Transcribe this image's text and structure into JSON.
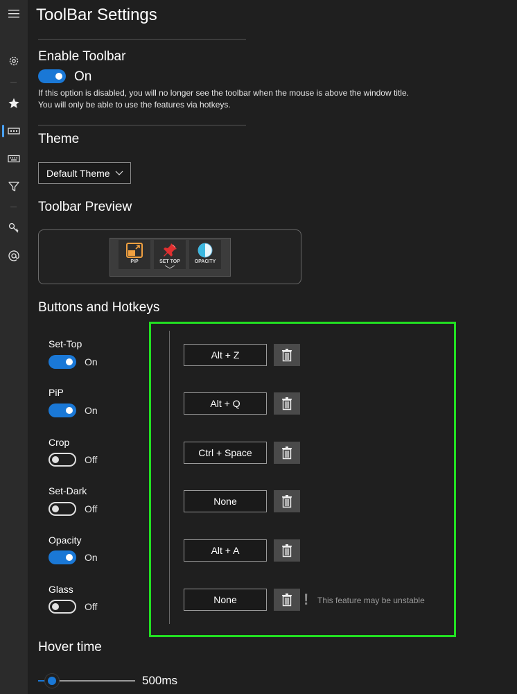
{
  "app": {
    "title": "ToolBar Settings"
  },
  "nav": {
    "items": [
      {
        "icon": "hamburger-icon"
      },
      {
        "icon": "gear-icon"
      },
      {
        "icon": "star-icon"
      },
      {
        "icon": "toolbar-icon"
      },
      {
        "icon": "keyboard-icon"
      },
      {
        "icon": "filter-icon"
      },
      {
        "icon": "key-icon"
      },
      {
        "icon": "at-icon"
      }
    ],
    "selected": "toolbar-icon"
  },
  "enable_toolbar": {
    "heading": "Enable Toolbar",
    "state_label": "On",
    "enabled": true,
    "description_line1": "If this option is disabled, you will no longer see the toolbar when the mouse is above the window title.",
    "description_line2": "You will only be able to use the features via hotkeys."
  },
  "theme": {
    "heading": "Theme",
    "selected": "Default Theme"
  },
  "preview": {
    "heading": "Toolbar Preview",
    "buttons": [
      {
        "label": "PIP",
        "icon": "pip-icon"
      },
      {
        "label": "SET TOP",
        "icon": "pushpin-icon"
      },
      {
        "label": "OPACITY",
        "icon": "opacity-icon"
      }
    ]
  },
  "buttons_hotkeys": {
    "heading": "Buttons and Hotkeys",
    "items": [
      {
        "name": "Set-Top",
        "state": "On",
        "enabled": true,
        "hotkey": "Alt + Z"
      },
      {
        "name": "PiP",
        "state": "On",
        "enabled": true,
        "hotkey": "Alt + Q"
      },
      {
        "name": "Crop",
        "state": "Off",
        "enabled": false,
        "hotkey": "Ctrl + Space"
      },
      {
        "name": "Set-Dark",
        "state": "Off",
        "enabled": false,
        "hotkey": "None"
      },
      {
        "name": "Opacity",
        "state": "On",
        "enabled": true,
        "hotkey": "Alt + A"
      },
      {
        "name": "Glass",
        "state": "Off",
        "enabled": false,
        "hotkey": "None"
      }
    ],
    "warning_text": "This feature may be unstable"
  },
  "hover_time": {
    "heading": "Hover time",
    "value_label": "500ms",
    "fraction": 0.14
  },
  "colors": {
    "accent": "#1a78d6",
    "highlight": "#22e022",
    "background": "#1f1f1f",
    "sidebar": "#2b2b2b"
  }
}
